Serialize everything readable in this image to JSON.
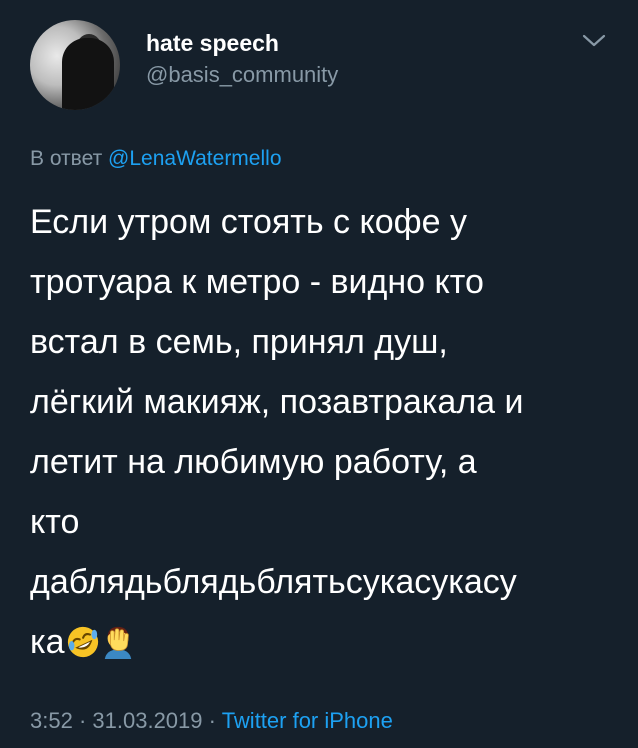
{
  "author": {
    "display_name": "hate speech",
    "handle": "@basis_community"
  },
  "reply": {
    "prefix": "В ответ",
    "to": "@LenaWatermello"
  },
  "tweet": {
    "lines": [
      "Если утром стоять с кофе у",
      "тротуара к метро - видно кто",
      "встал в семь, принял душ,",
      "лёгкий макияж, позавтракала и",
      "летит на любимую работу, а",
      "кто",
      "даблядьблядьблятьсукасукасу",
      "ка"
    ],
    "emojis": [
      "rolling-on-floor-laughing-icon",
      "face-palm-icon"
    ]
  },
  "meta": {
    "time": "3:52",
    "separator": "·",
    "date": "31.03.2019",
    "source": "Twitter for iPhone"
  },
  "colors": {
    "background": "#15202b",
    "text": "#ffffff",
    "secondary": "#8899a6",
    "link": "#1da1f2"
  }
}
